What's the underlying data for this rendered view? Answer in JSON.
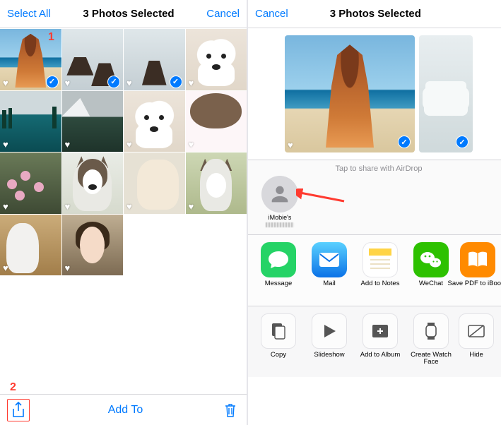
{
  "colors": {
    "accent": "#007aff",
    "annotation": "#ff3b30"
  },
  "annotations": {
    "num1": "1",
    "num2": "2"
  },
  "left": {
    "select_all": "Select All",
    "title": "3 Photos Selected",
    "cancel": "Cancel",
    "toolbar": {
      "add_to": "Add To"
    },
    "photos": [
      {
        "fav": true,
        "sel": true
      },
      {
        "fav": true,
        "sel": true
      },
      {
        "fav": true,
        "sel": true
      },
      {
        "fav": true,
        "sel": false
      },
      {
        "fav": true,
        "sel": false
      },
      {
        "fav": true,
        "sel": false
      },
      {
        "fav": true,
        "sel": false
      },
      {
        "fav": true,
        "sel": false
      },
      {
        "fav": true,
        "sel": false
      },
      {
        "fav": true,
        "sel": false
      },
      {
        "fav": true,
        "sel": false
      },
      {
        "fav": true,
        "sel": false
      },
      {
        "fav": true,
        "sel": false
      },
      {
        "fav": true,
        "sel": false
      }
    ]
  },
  "right": {
    "cancel": "Cancel",
    "title": "3 Photos Selected",
    "airdrop_caption": "Tap to share with AirDrop",
    "contact": {
      "name": "iMobie's"
    },
    "apps": [
      {
        "label": "Message",
        "bg": "#25d366"
      },
      {
        "label": "Mail",
        "bg": "linear-gradient(#3cc1ff,#0b72e7)"
      },
      {
        "label": "Add to Notes",
        "bg": "#ffffff"
      },
      {
        "label": "WeChat",
        "bg": "#2dc100"
      },
      {
        "label": "Save PDF to iBooks",
        "bg": "#ff8a00"
      }
    ],
    "actions": [
      {
        "label": "Copy"
      },
      {
        "label": "Slideshow"
      },
      {
        "label": "Add to Album"
      },
      {
        "label": "Create Watch Face"
      },
      {
        "label": "Hide"
      }
    ],
    "strip_selected": [
      true,
      true
    ]
  }
}
